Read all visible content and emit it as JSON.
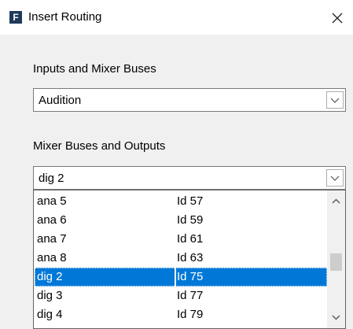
{
  "window": {
    "title": "Insert Routing",
    "app_icon_letter": "F"
  },
  "inputs": {
    "label": "Inputs and Mixer Buses",
    "selected": "Audition"
  },
  "outputs": {
    "label": "Mixer Buses and Outputs",
    "selected": "dig 2",
    "options": [
      {
        "name": "ana 5",
        "id": "Id 57"
      },
      {
        "name": "ana 6",
        "id": "Id 59"
      },
      {
        "name": "ana 7",
        "id": "Id 61"
      },
      {
        "name": "ana 8",
        "id": "Id 63"
      },
      {
        "name": "dig 2",
        "id": "Id 75",
        "selected": true
      },
      {
        "name": "dig 3",
        "id": "Id 77"
      },
      {
        "name": "dig 4",
        "id": "Id 79"
      }
    ]
  },
  "colors": {
    "selection": "#0078d7",
    "dialog_bg": "#f0f0f0",
    "app_icon_bg": "#1f3b5c"
  },
  "icons": {
    "app": "app-logo-icon",
    "close": "close-icon",
    "dropdown": "chevron-down-icon",
    "scroll_up": "chevron-up-icon",
    "scroll_down": "chevron-down-icon"
  }
}
